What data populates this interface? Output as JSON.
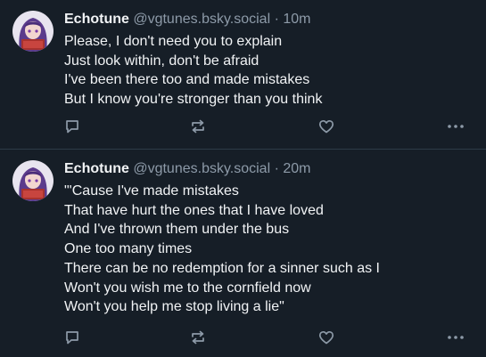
{
  "posts": [
    {
      "display_name": "Echotune",
      "handle": "@vgtunes.bsky.social",
      "separator": "·",
      "time": "10m",
      "lines": [
        "Please, I don't need you to explain",
        "Just look within, don't be afraid",
        "I've been there too and made mistakes",
        "But I know you're stronger than you think"
      ],
      "actions": [
        "reply-icon",
        "repost-icon",
        "like-icon",
        "more-icon"
      ]
    },
    {
      "display_name": "Echotune",
      "handle": "@vgtunes.bsky.social",
      "separator": "·",
      "time": "20m",
      "lines": [
        "\"'Cause I've made mistakes",
        "That have hurt the ones that I have loved",
        "And I've thrown them under the bus",
        "One too many times",
        "There can be no redemption for a sinner such as I",
        "Won't you wish me to the cornfield now",
        "Won't you help me stop living a lie\""
      ],
      "actions": [
        "reply-icon",
        "repost-icon",
        "like-icon",
        "more-icon"
      ]
    }
  ],
  "colors": {
    "background": "#161e27",
    "text": "#f1f3f5",
    "muted": "#8d9aa8",
    "divider": "#2e3b47",
    "avatar_hair": "#5b3a8c"
  }
}
